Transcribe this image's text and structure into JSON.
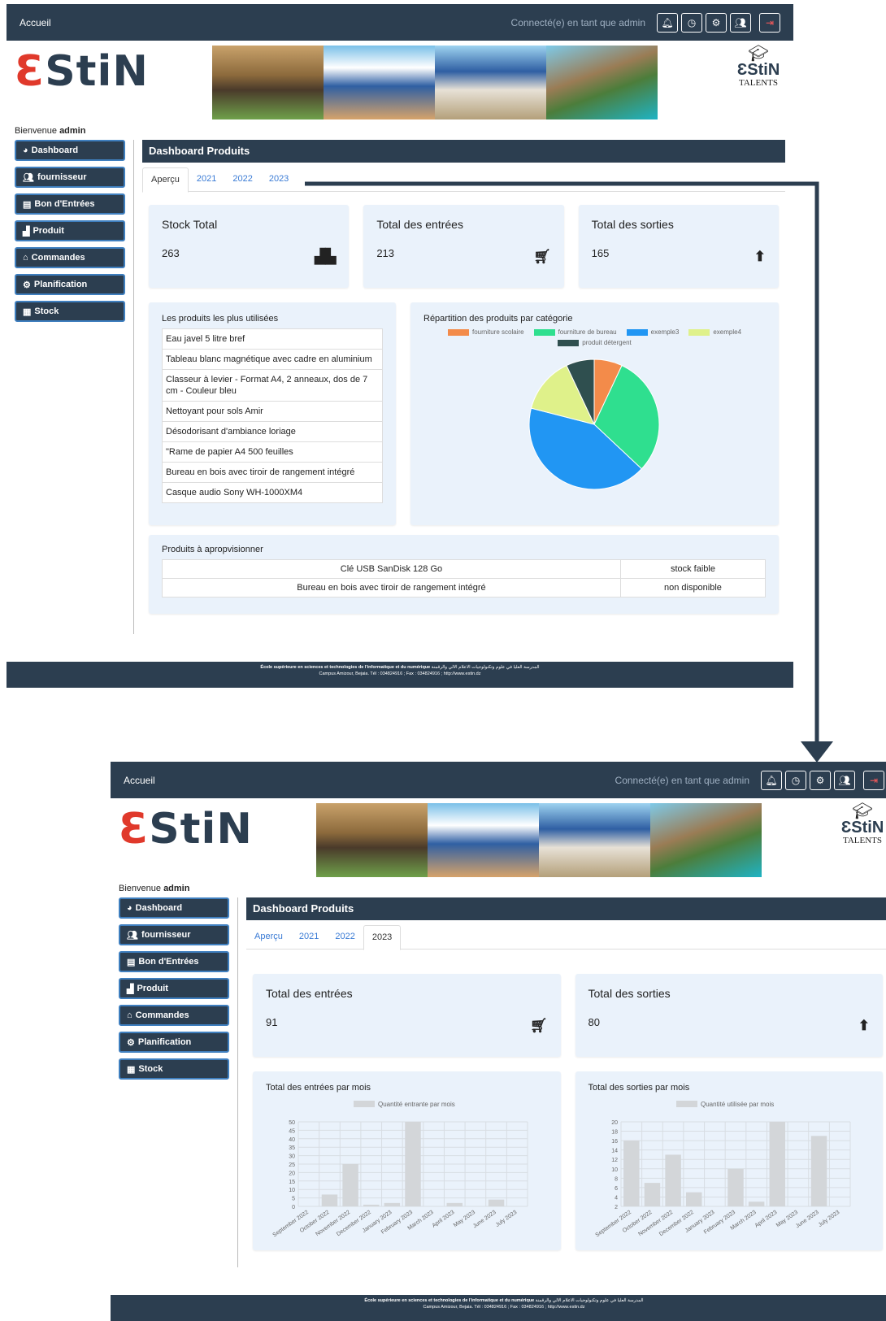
{
  "topbar": {
    "home": "Accueil",
    "connected": "Connecté(e) en tant que admin",
    "icons": [
      "bell-icon",
      "clock-icon",
      "gear-icon",
      "user-admin-icon",
      "logout-icon"
    ]
  },
  "welcome": {
    "prefix": "Bienvenue",
    "user": "admin"
  },
  "talents": "TALENTS",
  "sidebar": {
    "items": [
      {
        "label": "Dashboard",
        "icon": "pie-icon"
      },
      {
        "label": "fournisseur",
        "icon": "users-icon"
      },
      {
        "label": "Bon d'Entrées",
        "icon": "file-icon"
      },
      {
        "label": "Produit",
        "icon": "boxes-icon"
      },
      {
        "label": "Commandes",
        "icon": "basket-icon"
      },
      {
        "label": "Planification",
        "icon": "cogs-icon"
      },
      {
        "label": "Stock",
        "icon": "warehouse-icon"
      }
    ]
  },
  "main": {
    "title": "Dashboard Produits",
    "tabs": [
      "Aperçu",
      "2021",
      "2022",
      "2023"
    ]
  },
  "overview": {
    "stats": [
      {
        "title": "Stock Total",
        "value": "263",
        "icon": "boxes-icon"
      },
      {
        "title": "Total des entrées",
        "value": "213",
        "icon": "cart-icon"
      },
      {
        "title": "Total des sorties",
        "value": "165",
        "icon": "arrow-up-circle-icon"
      }
    ],
    "most_used_title": "Les produits les plus utilisées",
    "most_used": [
      "Eau javel 5 litre bref",
      "Tableau blanc magnétique avec cadre en aluminium",
      "Classeur à levier - Format A4, 2 anneaux, dos de 7 cm - Couleur bleu",
      "Nettoyant pour sols Amir",
      "Désodorisant d'ambiance loriage",
      "\"Rame de papier A4 500 feuilles",
      "Bureau en bois avec tiroir de rangement intégré",
      "Casque audio Sony WH-1000XM4"
    ],
    "pie_title": "Répartition des produits par catégorie",
    "restock_title": "Produits à apropvisionner",
    "restock": [
      {
        "product": "Clé USB SanDisk 128 Go",
        "status": "stock faible"
      },
      {
        "product": "Bureau en bois avec tiroir de rangement intégré",
        "status": "non disponible"
      }
    ]
  },
  "year2023": {
    "stats": [
      {
        "title": "Total des entrées",
        "value": "91",
        "icon": "cart-icon"
      },
      {
        "title": "Total des sorties",
        "value": "80",
        "icon": "arrow-up-circle-icon"
      }
    ],
    "in_title": "Total des entrées par mois",
    "out_title": "Total des sorties par mois"
  },
  "footer": {
    "line1_bold": "École supérieure en sciences et technologies de l'informatique et du numérique",
    "line1_ar": "المدرسة العليا في علوم وتكنولوجيات الاعلام الالي والرقمنة",
    "line2": "Campus Amizour, Bejaia. Tél : 034824916 ; Fax : 034824916 ; http://www.estin.dz"
  },
  "colors": {
    "navy": "#2c3e50",
    "card": "#eaf2fb",
    "link": "#3a7bd5",
    "logo_accent": "#e0392b"
  },
  "chart_data": [
    {
      "type": "pie",
      "title": "Répartition des produits par catégorie",
      "categories": [
        "fourniture scolaire",
        "fourniture de bureau",
        "exemple3",
        "exemple4",
        "produit détergent"
      ],
      "values": [
        7,
        30,
        42,
        14,
        7
      ],
      "colors": [
        "#f38b4a",
        "#2fdf8f",
        "#2196f3",
        "#dff18a",
        "#2f4f4f"
      ]
    },
    {
      "type": "bar",
      "title": "Total des entrées par mois",
      "categories": [
        "September 2022",
        "October 2022",
        "November 2022",
        "December 2022",
        "January 2023",
        "February 2023",
        "March 2023",
        "April 2023",
        "May 2023",
        "June 2023",
        "July 2023"
      ],
      "series": [
        {
          "name": "Quantité entrante par mois",
          "values": [
            0,
            7,
            25,
            1,
            2,
            50,
            0,
            2,
            0,
            4,
            0
          ]
        }
      ],
      "ylim": [
        0,
        50
      ],
      "yticks": [
        0,
        5,
        10,
        15,
        20,
        25,
        30,
        35,
        40,
        45,
        50
      ],
      "grid": true,
      "legend": "top",
      "color": "#d3d6d9"
    },
    {
      "type": "bar",
      "title": "Total des sorties par mois",
      "categories": [
        "September 2022",
        "October 2022",
        "November 2022",
        "December 2022",
        "January 2023",
        "February 2023",
        "March 2023",
        "April 2023",
        "May 2023",
        "June 2023",
        "July 2023"
      ],
      "series": [
        {
          "name": "Quantité utilisée par mois",
          "values": [
            16,
            7,
            13,
            5,
            0,
            10,
            3,
            20,
            0,
            17,
            0
          ]
        }
      ],
      "ylim": [
        2,
        20
      ],
      "yticks": [
        2,
        4,
        6,
        8,
        10,
        12,
        14,
        16,
        18,
        20
      ],
      "grid": true,
      "legend": "top",
      "color": "#d3d6d9"
    }
  ]
}
